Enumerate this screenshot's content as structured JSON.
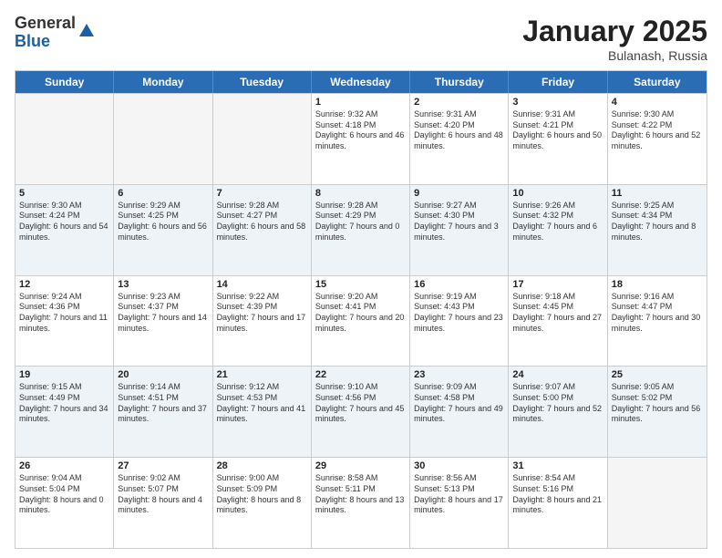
{
  "header": {
    "logo_general": "General",
    "logo_blue": "Blue",
    "month_title": "January 2025",
    "location": "Bulanash, Russia"
  },
  "weekdays": [
    "Sunday",
    "Monday",
    "Tuesday",
    "Wednesday",
    "Thursday",
    "Friday",
    "Saturday"
  ],
  "rows": [
    [
      {
        "day": "",
        "sunrise": "",
        "sunset": "",
        "daylight": "",
        "empty": true
      },
      {
        "day": "",
        "sunrise": "",
        "sunset": "",
        "daylight": "",
        "empty": true
      },
      {
        "day": "",
        "sunrise": "",
        "sunset": "",
        "daylight": "",
        "empty": true
      },
      {
        "day": "1",
        "sunrise": "Sunrise: 9:32 AM",
        "sunset": "Sunset: 4:18 PM",
        "daylight": "Daylight: 6 hours and 46 minutes."
      },
      {
        "day": "2",
        "sunrise": "Sunrise: 9:31 AM",
        "sunset": "Sunset: 4:20 PM",
        "daylight": "Daylight: 6 hours and 48 minutes."
      },
      {
        "day": "3",
        "sunrise": "Sunrise: 9:31 AM",
        "sunset": "Sunset: 4:21 PM",
        "daylight": "Daylight: 6 hours and 50 minutes."
      },
      {
        "day": "4",
        "sunrise": "Sunrise: 9:30 AM",
        "sunset": "Sunset: 4:22 PM",
        "daylight": "Daylight: 6 hours and 52 minutes."
      }
    ],
    [
      {
        "day": "5",
        "sunrise": "Sunrise: 9:30 AM",
        "sunset": "Sunset: 4:24 PM",
        "daylight": "Daylight: 6 hours and 54 minutes."
      },
      {
        "day": "6",
        "sunrise": "Sunrise: 9:29 AM",
        "sunset": "Sunset: 4:25 PM",
        "daylight": "Daylight: 6 hours and 56 minutes."
      },
      {
        "day": "7",
        "sunrise": "Sunrise: 9:28 AM",
        "sunset": "Sunset: 4:27 PM",
        "daylight": "Daylight: 6 hours and 58 minutes."
      },
      {
        "day": "8",
        "sunrise": "Sunrise: 9:28 AM",
        "sunset": "Sunset: 4:29 PM",
        "daylight": "Daylight: 7 hours and 0 minutes."
      },
      {
        "day": "9",
        "sunrise": "Sunrise: 9:27 AM",
        "sunset": "Sunset: 4:30 PM",
        "daylight": "Daylight: 7 hours and 3 minutes."
      },
      {
        "day": "10",
        "sunrise": "Sunrise: 9:26 AM",
        "sunset": "Sunset: 4:32 PM",
        "daylight": "Daylight: 7 hours and 6 minutes."
      },
      {
        "day": "11",
        "sunrise": "Sunrise: 9:25 AM",
        "sunset": "Sunset: 4:34 PM",
        "daylight": "Daylight: 7 hours and 8 minutes."
      }
    ],
    [
      {
        "day": "12",
        "sunrise": "Sunrise: 9:24 AM",
        "sunset": "Sunset: 4:36 PM",
        "daylight": "Daylight: 7 hours and 11 minutes."
      },
      {
        "day": "13",
        "sunrise": "Sunrise: 9:23 AM",
        "sunset": "Sunset: 4:37 PM",
        "daylight": "Daylight: 7 hours and 14 minutes."
      },
      {
        "day": "14",
        "sunrise": "Sunrise: 9:22 AM",
        "sunset": "Sunset: 4:39 PM",
        "daylight": "Daylight: 7 hours and 17 minutes."
      },
      {
        "day": "15",
        "sunrise": "Sunrise: 9:20 AM",
        "sunset": "Sunset: 4:41 PM",
        "daylight": "Daylight: 7 hours and 20 minutes."
      },
      {
        "day": "16",
        "sunrise": "Sunrise: 9:19 AM",
        "sunset": "Sunset: 4:43 PM",
        "daylight": "Daylight: 7 hours and 23 minutes."
      },
      {
        "day": "17",
        "sunrise": "Sunrise: 9:18 AM",
        "sunset": "Sunset: 4:45 PM",
        "daylight": "Daylight: 7 hours and 27 minutes."
      },
      {
        "day": "18",
        "sunrise": "Sunrise: 9:16 AM",
        "sunset": "Sunset: 4:47 PM",
        "daylight": "Daylight: 7 hours and 30 minutes."
      }
    ],
    [
      {
        "day": "19",
        "sunrise": "Sunrise: 9:15 AM",
        "sunset": "Sunset: 4:49 PM",
        "daylight": "Daylight: 7 hours and 34 minutes."
      },
      {
        "day": "20",
        "sunrise": "Sunrise: 9:14 AM",
        "sunset": "Sunset: 4:51 PM",
        "daylight": "Daylight: 7 hours and 37 minutes."
      },
      {
        "day": "21",
        "sunrise": "Sunrise: 9:12 AM",
        "sunset": "Sunset: 4:53 PM",
        "daylight": "Daylight: 7 hours and 41 minutes."
      },
      {
        "day": "22",
        "sunrise": "Sunrise: 9:10 AM",
        "sunset": "Sunset: 4:56 PM",
        "daylight": "Daylight: 7 hours and 45 minutes."
      },
      {
        "day": "23",
        "sunrise": "Sunrise: 9:09 AM",
        "sunset": "Sunset: 4:58 PM",
        "daylight": "Daylight: 7 hours and 49 minutes."
      },
      {
        "day": "24",
        "sunrise": "Sunrise: 9:07 AM",
        "sunset": "Sunset: 5:00 PM",
        "daylight": "Daylight: 7 hours and 52 minutes."
      },
      {
        "day": "25",
        "sunrise": "Sunrise: 9:05 AM",
        "sunset": "Sunset: 5:02 PM",
        "daylight": "Daylight: 7 hours and 56 minutes."
      }
    ],
    [
      {
        "day": "26",
        "sunrise": "Sunrise: 9:04 AM",
        "sunset": "Sunset: 5:04 PM",
        "daylight": "Daylight: 8 hours and 0 minutes."
      },
      {
        "day": "27",
        "sunrise": "Sunrise: 9:02 AM",
        "sunset": "Sunset: 5:07 PM",
        "daylight": "Daylight: 8 hours and 4 minutes."
      },
      {
        "day": "28",
        "sunrise": "Sunrise: 9:00 AM",
        "sunset": "Sunset: 5:09 PM",
        "daylight": "Daylight: 8 hours and 8 minutes."
      },
      {
        "day": "29",
        "sunrise": "Sunrise: 8:58 AM",
        "sunset": "Sunset: 5:11 PM",
        "daylight": "Daylight: 8 hours and 13 minutes."
      },
      {
        "day": "30",
        "sunrise": "Sunrise: 8:56 AM",
        "sunset": "Sunset: 5:13 PM",
        "daylight": "Daylight: 8 hours and 17 minutes."
      },
      {
        "day": "31",
        "sunrise": "Sunrise: 8:54 AM",
        "sunset": "Sunset: 5:16 PM",
        "daylight": "Daylight: 8 hours and 21 minutes."
      },
      {
        "day": "",
        "sunrise": "",
        "sunset": "",
        "daylight": "",
        "empty": true
      }
    ]
  ]
}
